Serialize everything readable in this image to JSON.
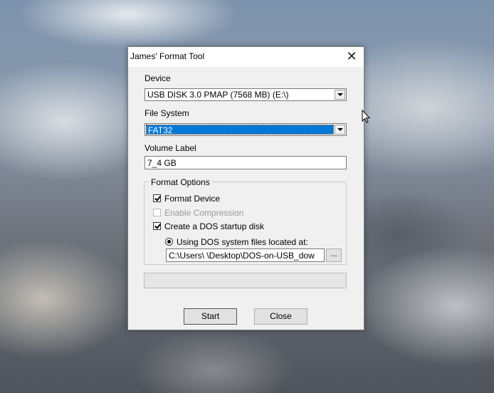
{
  "window": {
    "title": "James' Format Tool",
    "close_glyph": "✕"
  },
  "device": {
    "label": "Device",
    "value": "USB DISK 3.0 PMAP (7568 MB) (E:\\)"
  },
  "file_system": {
    "label": "File System",
    "value": "FAT32"
  },
  "volume_label": {
    "label": "Volume Label",
    "value": "7_4 GB"
  },
  "format_options": {
    "legend": "Format Options",
    "format_device": "Format Device",
    "enable_compression": "Enable Compression",
    "create_dos_disk": "Create a DOS startup disk",
    "using_dos_files": "Using DOS system files located at:",
    "dos_path": "C:\\Users\\          \\Desktop\\DOS-on-USB_dow",
    "browse_label": "..."
  },
  "checks": {
    "format_device": true,
    "enable_compression": false,
    "create_dos_disk": true
  },
  "progress": 0,
  "buttons": {
    "start": "Start",
    "close": "Close"
  },
  "colors": {
    "selection": "#0078d7",
    "window_bg": "#f0f0f0"
  }
}
